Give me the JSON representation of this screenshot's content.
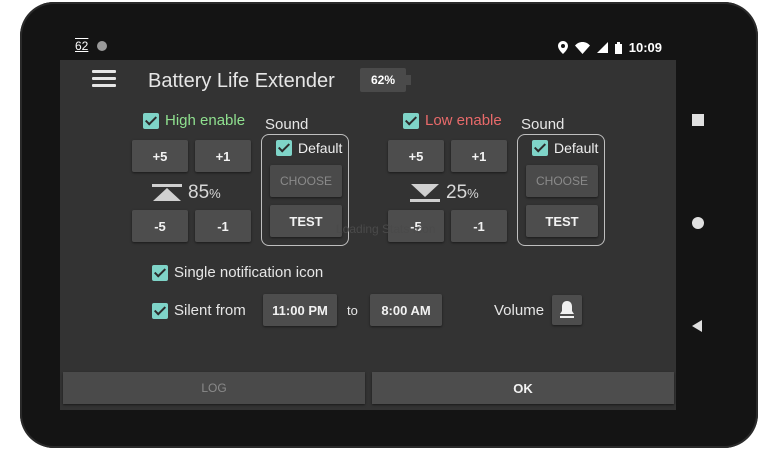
{
  "status_bar": {
    "notification_number": "62",
    "time": "10:09"
  },
  "app": {
    "title": "Battery Life Extender",
    "battery_level": "62%"
  },
  "high": {
    "enable_label": "High enable",
    "enable_color": "#8fe08f",
    "plus5": "+5",
    "plus1": "+1",
    "minus5": "-5",
    "minus1": "-1",
    "percent_value": "85",
    "percent_sign": "%",
    "sound_label": "Sound",
    "default_label": "Default",
    "choose_label": "CHOOSE",
    "test_label": "TEST"
  },
  "low": {
    "enable_label": "Low enable",
    "enable_color": "#e86a6a",
    "plus5": "+5",
    "plus1": "+1",
    "minus5": "-5",
    "minus1": "-1",
    "percent_value": "25",
    "percent_sign": "%",
    "sound_label": "Sound",
    "default_label": "Default",
    "choose_label": "CHOOSE",
    "test_label": "TEST"
  },
  "options": {
    "single_notification_label": "Single notification icon",
    "silent_label": "Silent from",
    "silent_start": "11:00 PM",
    "to_label": "to",
    "silent_end": "8:00 AM",
    "volume_label": "Volume"
  },
  "watermark": "Loading Stats Icon",
  "footer": {
    "log_label": "LOG",
    "ok_label": "OK"
  },
  "colors": {
    "accent": "#7fd4c8",
    "screen_bg": "#333333",
    "button_bg": "#4d4d4d"
  }
}
